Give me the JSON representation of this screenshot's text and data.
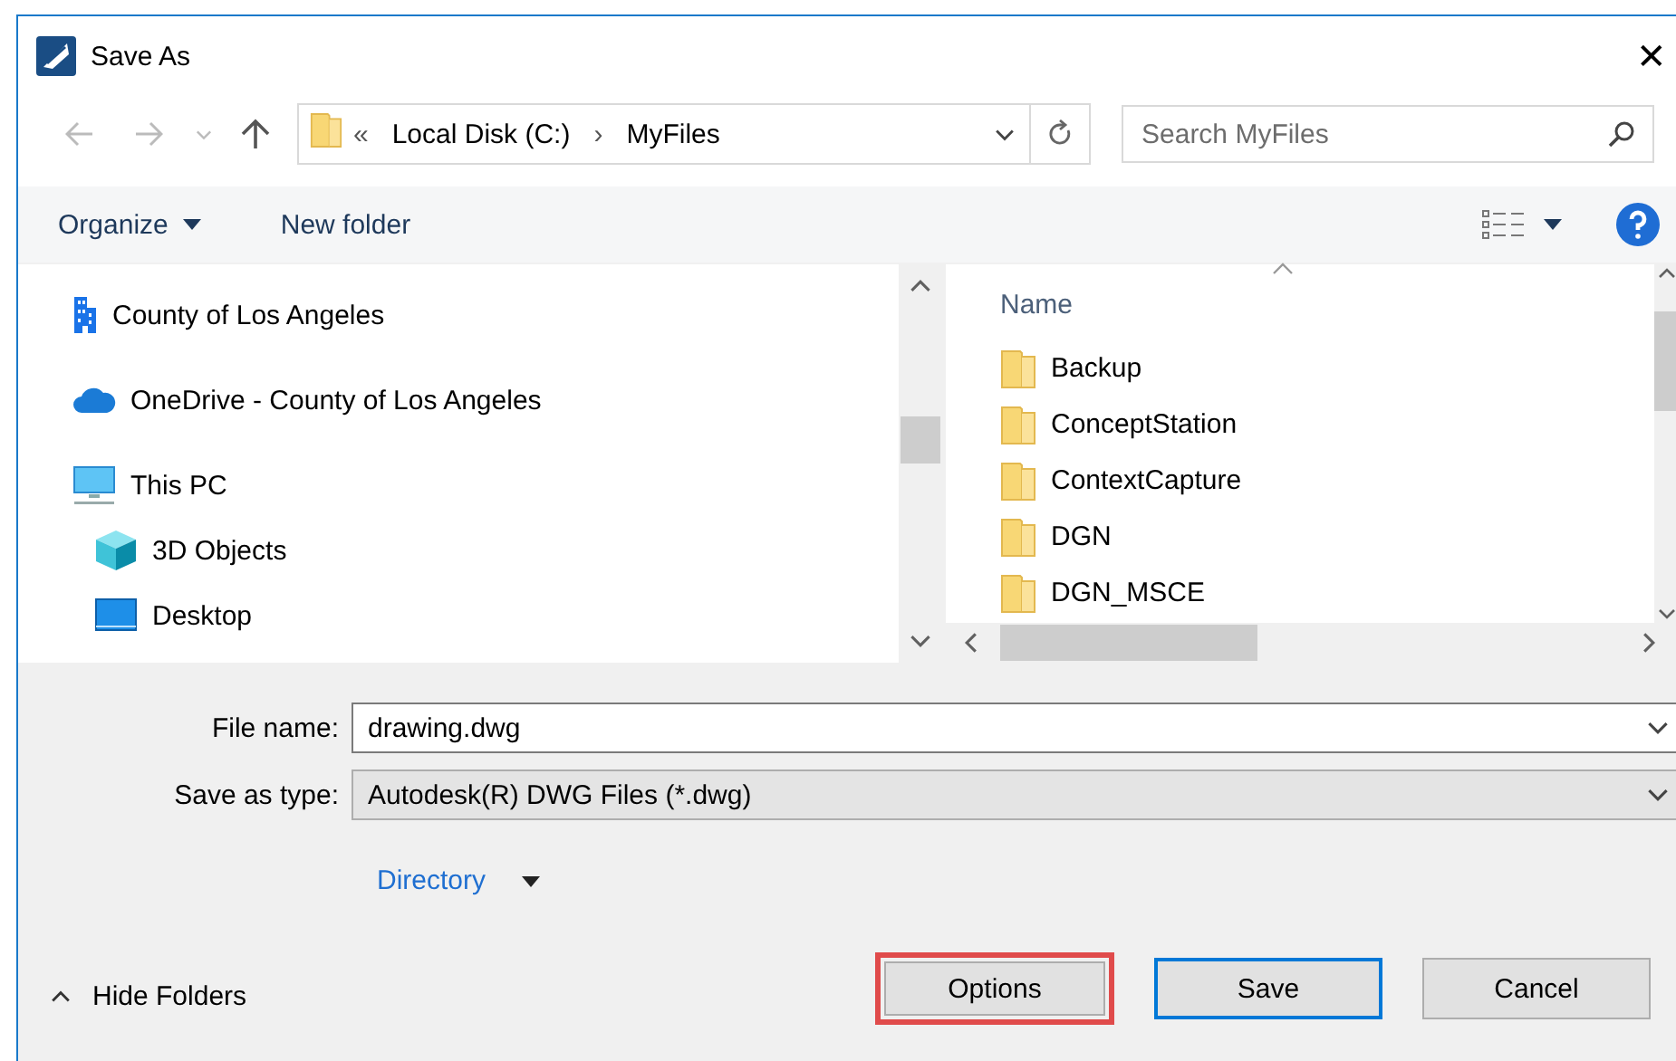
{
  "window": {
    "title": "Save As",
    "close": "✕"
  },
  "navigation": {
    "overflow": "«",
    "separator": "›",
    "path": [
      {
        "label": "Local Disk (C:)"
      },
      {
        "label": "MyFiles"
      }
    ],
    "search": {
      "placeholder": "Search MyFiles"
    }
  },
  "toolbar": {
    "organize": "Organize",
    "new_folder": "New folder"
  },
  "sidebar": {
    "items": [
      {
        "label": "County of Los Angeles",
        "kind": "building"
      },
      {
        "label": "OneDrive - County of Los Angeles",
        "kind": "cloud"
      },
      {
        "label": "This PC",
        "kind": "monitor",
        "children": [
          {
            "label": "3D Objects",
            "kind": "cube"
          },
          {
            "label": "Desktop",
            "kind": "desktop"
          }
        ]
      }
    ]
  },
  "file_list": {
    "columns": [
      {
        "label": "Name"
      }
    ],
    "rows": [
      {
        "name": "Backup"
      },
      {
        "name": "ConceptStation"
      },
      {
        "name": "ContextCapture"
      },
      {
        "name": "DGN"
      },
      {
        "name": "DGN_MSCE"
      }
    ]
  },
  "form": {
    "file_name": {
      "label": "File name:",
      "value": "drawing.dwg"
    },
    "save_type": {
      "label": "Save as type:",
      "value": "Autodesk(R) DWG Files (*.dwg)"
    }
  },
  "directory": {
    "label": "Directory"
  },
  "hide_folders": {
    "label": "Hide Folders"
  },
  "buttons": [
    {
      "label": "Options",
      "default": false,
      "highlighted": true
    },
    {
      "label": "Save",
      "default": true,
      "highlighted": false
    },
    {
      "label": "Cancel",
      "default": false,
      "highlighted": false
    }
  ]
}
